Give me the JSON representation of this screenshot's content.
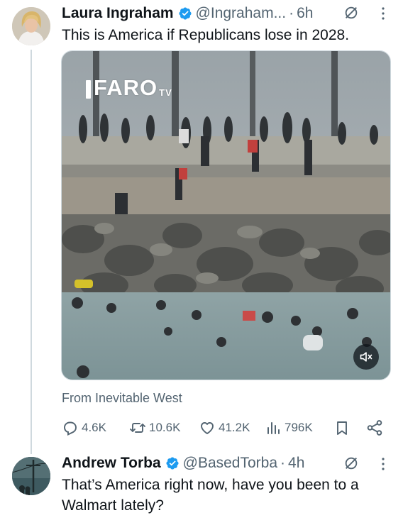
{
  "tweet": {
    "author_name": "Laura Ingraham",
    "handle": "@Ingraham...",
    "separator": "·",
    "time": "6h",
    "text": "This is America if Republicans lose in 2028.",
    "media": {
      "watermark_text": "FARO",
      "watermark_suffix": "TV",
      "overlay_watermark": "FARO",
      "mute_icon": "speaker-muted-icon"
    },
    "source": "From Inevitable West",
    "stats": {
      "replies": "4.6K",
      "retweets": "10.6K",
      "likes": "41.2K",
      "views": "796K"
    }
  },
  "reply": {
    "author_name": "Andrew Torba",
    "handle": "@BasedTorba",
    "separator": "·",
    "time": "4h",
    "text": "That’s America right now, have you been to a Walmart lately?"
  },
  "colors": {
    "verified": "#1d9bf0",
    "muted_text": "#536471",
    "primary_text": "#0f1419",
    "divider": "#cfd9de"
  }
}
